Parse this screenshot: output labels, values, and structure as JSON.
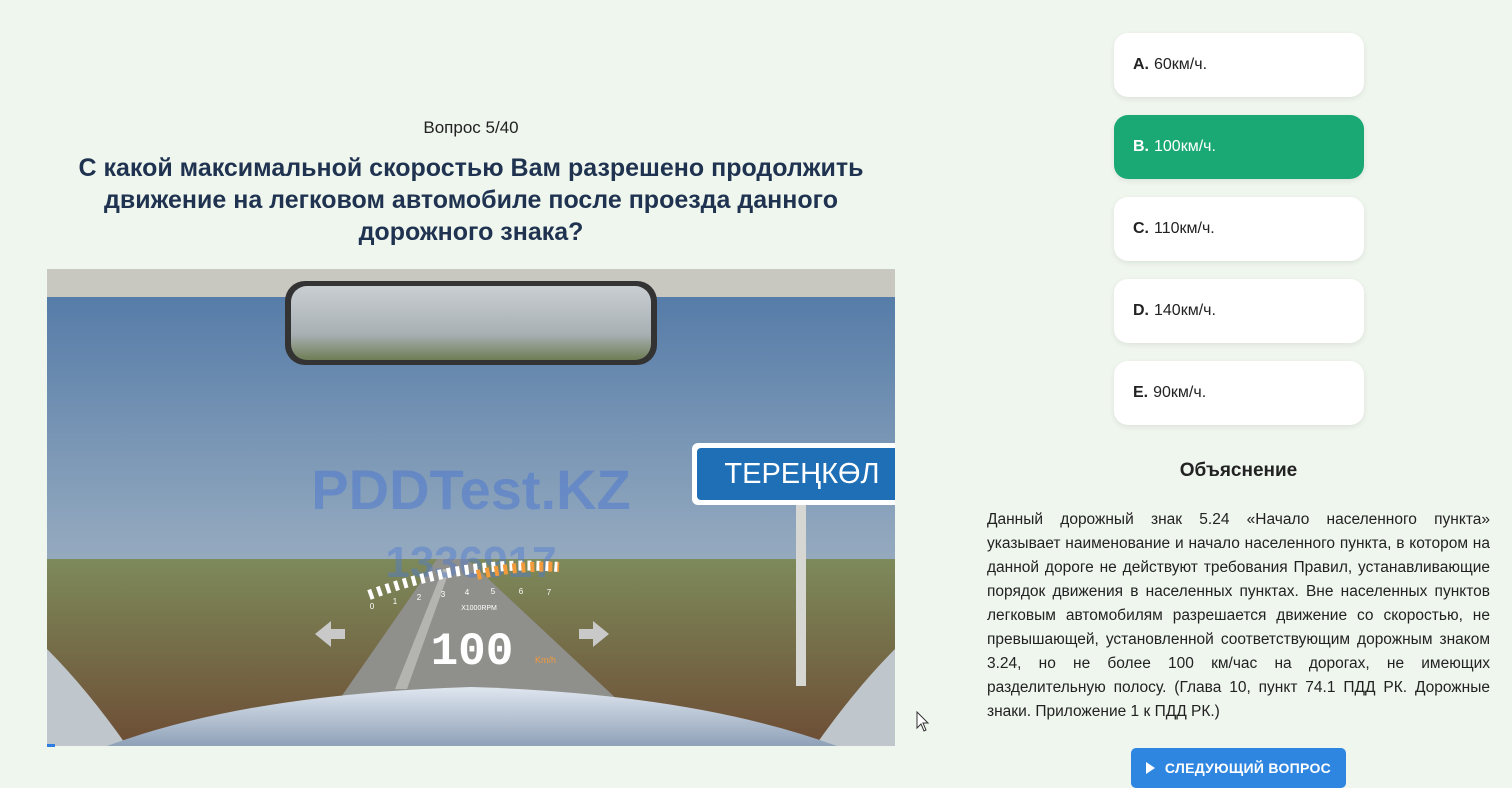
{
  "question": {
    "counter": "Вопрос 5/40",
    "text": "С какой максимальной скоростью Вам разрешено продолжить движение на легковом автомобиле после проезда данного дорожного знака?",
    "progress_percent": 1
  },
  "scene": {
    "watermark": "PDDTest.KZ",
    "watermark_id": "1336917",
    "sign_text": "ТЕРЕҢКӨЛ",
    "hud_speed": "100",
    "hud_unit": "Km/h",
    "hud_rpm_label": "X1000RPM",
    "hud_rpm_ticks": [
      "0",
      "1",
      "2",
      "3",
      "4",
      "5",
      "6",
      "7"
    ]
  },
  "answers": [
    {
      "letter": "A.",
      "text": "60км/ч.",
      "selected": false
    },
    {
      "letter": "B.",
      "text": "100км/ч.",
      "selected": true
    },
    {
      "letter": "C.",
      "text": "110км/ч.",
      "selected": false
    },
    {
      "letter": "D.",
      "text": "140км/ч.",
      "selected": false
    },
    {
      "letter": "E.",
      "text": "90км/ч.",
      "selected": false
    }
  ],
  "explanation": {
    "title": "Объяснение",
    "text": "Данный дорожный знак 5.24 «Начало населенного пункта» указывает наименование и начало населенного пункта, в котором на данной дороге не действуют требования Правил, устанавливающие порядок движения в населенных пунктах. Вне населенных пунктов легковым автомобилям разрешается движение со скоростью, не превышающей, установленной соответствующим дорожным знаком 3.24, но не более 100 км/час на дорогах, не имеющих разделительную полосу. (Глава 10, пункт 74.1 ПДД РК. Дорожные знаки. Приложение 1 к ПДД РК.)"
  },
  "next_button": {
    "label": "СЛЕДУЮЩИЙ ВОПРОС",
    "icon": "play-icon"
  },
  "colors": {
    "selected": "#1aa874",
    "button": "#2f86e0",
    "background": "#eff6ee"
  }
}
